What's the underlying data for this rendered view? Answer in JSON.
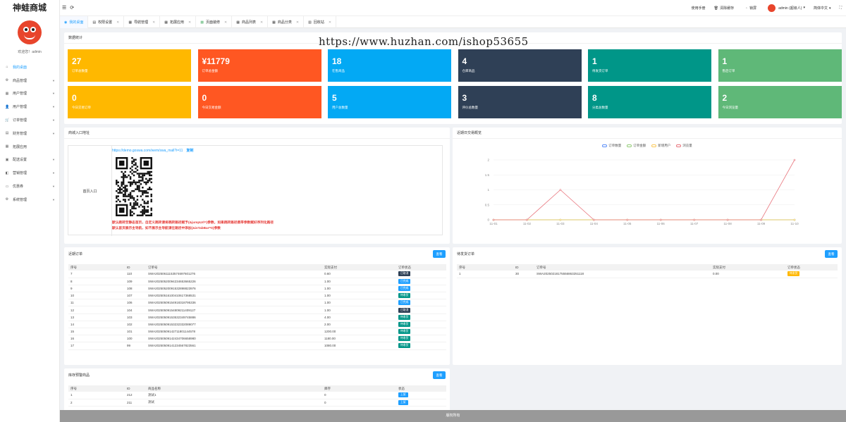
{
  "app": {
    "brand": "神蛙商城",
    "welcome": "欢迎您！admin"
  },
  "sidebar": {
    "items": [
      {
        "label": "我的桌面",
        "icon": "home-icon",
        "caret": false,
        "active": true
      },
      {
        "label": "商品管理",
        "icon": "gear-icon",
        "caret": true
      },
      {
        "label": "用户管理",
        "icon": "grid-icon",
        "caret": true
      },
      {
        "label": "用户管理",
        "icon": "user-icon",
        "caret": true
      },
      {
        "label": "订单管理",
        "icon": "cart-icon",
        "caret": true
      },
      {
        "label": "财务管理",
        "icon": "wallet-icon",
        "caret": true
      },
      {
        "label": "拓展应用",
        "icon": "apps-icon",
        "caret": false
      },
      {
        "label": "配送设置",
        "icon": "truck-icon",
        "caret": true
      },
      {
        "label": "营销管理",
        "icon": "megaphone-icon",
        "caret": true
      },
      {
        "label": "优惠券",
        "icon": "coupon-icon",
        "caret": true
      },
      {
        "label": "系统管理",
        "icon": "settings-icon",
        "caret": true
      }
    ]
  },
  "topbar": {
    "menu_icon": "☰",
    "refresh_icon": "⟳",
    "manual": "使用手册",
    "clear_cache": "清除缓存",
    "lock": "锁屏",
    "user": "admin (超级人)",
    "language": "简体中文"
  },
  "tabs": [
    {
      "label": "我的桌面",
      "active": true,
      "closable": false
    },
    {
      "label": "权限设置",
      "closable": true
    },
    {
      "label": "导航管理",
      "closable": true
    },
    {
      "label": "拓展应用",
      "closable": true
    },
    {
      "label": "页面装修",
      "closable": true
    },
    {
      "label": "商品列表",
      "closable": true
    },
    {
      "label": "商品分类",
      "closable": true
    },
    {
      "label": "回收站",
      "closable": true
    }
  ],
  "watermark": "https://www.huzhan.com/ishop53655",
  "stats": {
    "title": "数据统计",
    "cards": [
      {
        "value": "27",
        "label": "订单总数量",
        "color": "#ffb800"
      },
      {
        "value": "¥11779",
        "label": "订单总金额",
        "color": "#ff5722"
      },
      {
        "value": "18",
        "label": "在售商品",
        "color": "#03a9f4"
      },
      {
        "value": "4",
        "label": "仓库商品",
        "color": "#2f4056"
      },
      {
        "value": "1",
        "label": "待发货订单",
        "color": "#009688"
      },
      {
        "value": "1",
        "label": "售后订单",
        "color": "#5fb878"
      },
      {
        "value": "0",
        "label": "今日交易订单",
        "color": "#ffb800"
      },
      {
        "value": "0",
        "label": "今日交易金额",
        "color": "#ff5722"
      },
      {
        "value": "5",
        "label": "用户总数量",
        "color": "#03a9f4"
      },
      {
        "value": "3",
        "label": "评价总数量",
        "color": "#2f4056"
      },
      {
        "value": "8",
        "label": "分类总数量",
        "color": "#009688"
      },
      {
        "value": "2",
        "label": "今日浏览量",
        "color": "#5fb878"
      }
    ]
  },
  "entry": {
    "title": "商城入口地址",
    "label": "首页入口",
    "url": "https://demo.goswa.com/wem/swa_mall?i=11",
    "copy": "复制",
    "note_line1": "默认跳转至静态首页，自定义跳转请将跳转路径赋予{&jumpUrl=}参数，如果跳转路径携带参数赋好序列化路径",
    "note_line2": "默认首页展示主导航，如不展示主导航请在路径中添加{&isTabBar=0}参数"
  },
  "chart_data": {
    "type": "line",
    "title": "近期日交易概览",
    "categories": [
      "11-01",
      "11-02",
      "11-03",
      "11-04",
      "11-05",
      "11-06",
      "11-07",
      "11-08",
      "11-09",
      "11-10"
    ],
    "series": [
      {
        "name": "订单数量",
        "color": "#5b8ff9",
        "values": [
          0,
          0,
          0,
          0,
          0,
          0,
          0,
          0,
          0,
          0
        ]
      },
      {
        "name": "订单金额",
        "color": "#91cc75",
        "values": [
          0,
          0,
          0,
          0,
          0,
          0,
          0,
          0,
          0,
          0
        ]
      },
      {
        "name": "新增用户",
        "color": "#fac858",
        "values": [
          0,
          0,
          0,
          0,
          0,
          0,
          0,
          0,
          0,
          0
        ]
      },
      {
        "name": "浏览量",
        "color": "#e8747c",
        "values": [
          0,
          0,
          1,
          0,
          0,
          0,
          0,
          0,
          0,
          2
        ]
      }
    ],
    "yticks": [
      "0",
      "0.5",
      "1",
      "1.5",
      "2"
    ],
    "ylim": [
      0,
      2
    ]
  },
  "recent_orders": {
    "title": "近期订单",
    "view": "查看",
    "headers": [
      "序号",
      "ID",
      "订单号",
      "实际支付",
      "订单状态"
    ],
    "rows": [
      [
        "7",
        "110",
        "SWA20250611153574697601276",
        "0.60",
        "已取消",
        "#2f4056"
      ],
      [
        "8",
        "109",
        "SWA20250520094234653665226",
        "1.00",
        "已完成",
        "#1e9fff"
      ],
      [
        "9",
        "108",
        "SWA20250520091532898823976",
        "1.00",
        "已完成",
        "#1e9fff"
      ],
      [
        "10",
        "107",
        "SWA20250516100410617368531",
        "1.00",
        "待收货",
        "#009688"
      ],
      [
        "11",
        "106",
        "SWA20250509154918318795336",
        "1.00",
        "已完成",
        "#1e9fff"
      ],
      [
        "12",
        "104",
        "SWA20250509154809211409127",
        "1.00",
        "已取消",
        "#2f4056"
      ],
      [
        "13",
        "103",
        "SWA20250509153532349745886",
        "4.00",
        "待收货",
        "#009688"
      ],
      [
        "14",
        "102",
        "SWA20250509153232332089077",
        "2.00",
        "待收货",
        "#009688"
      ],
      [
        "15",
        "101",
        "SWA20250509142711801144578",
        "1200.00",
        "待收货",
        "#009688"
      ],
      [
        "16",
        "100",
        "SWA20250509142434706658980",
        "1180.00",
        "待收货",
        "#009688"
      ],
      [
        "17",
        "99",
        "SWA20250509141234567823561",
        "1080.00",
        "待收货",
        "#009688"
      ]
    ]
  },
  "pending_orders": {
    "title": "待发货订单",
    "view": "查看",
    "headers": [
      "序号",
      "ID",
      "订单号",
      "实际支付",
      "订单状态"
    ],
    "rows": [
      [
        "1",
        "30",
        "SWA20250218175556863251118",
        "0.00",
        "待发货",
        "#ffb800"
      ]
    ]
  },
  "stock_alert": {
    "title": "库存预警商品",
    "view": "查看",
    "headers": [
      "序号",
      "ID",
      "商品名称",
      "库存",
      "状态"
    ],
    "rows": [
      [
        "1",
        "212",
        "测试1",
        "0",
        "上架",
        "#1e9fff"
      ],
      [
        "2",
        "211",
        "测试",
        "0",
        "上架",
        "#1e9fff"
      ]
    ]
  },
  "footer": "版权所有"
}
